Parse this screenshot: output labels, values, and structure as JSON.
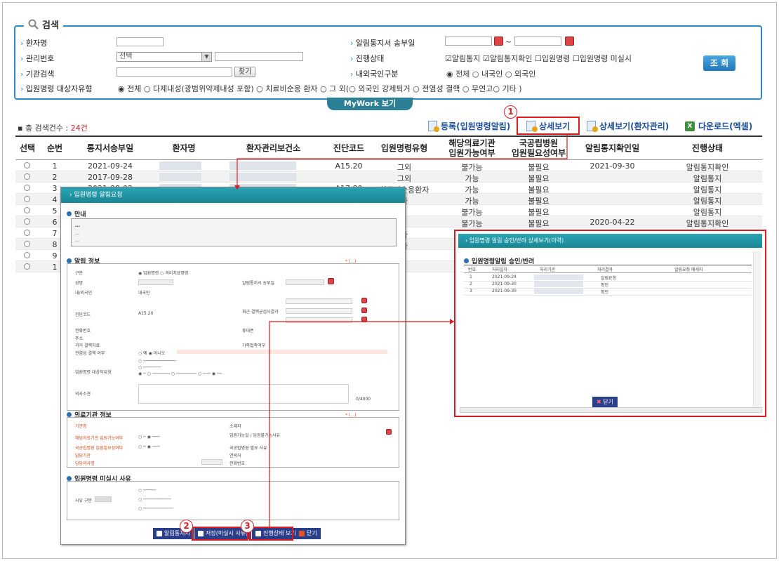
{
  "search": {
    "title": "검색",
    "patient_name_label": "환자명",
    "mgmt_no_label": "관리번호",
    "mgmt_select": "선택",
    "org_search_label": "기관검색",
    "find_btn": "찾기",
    "admission_type_label": "입원명령 대상자유형",
    "admission_type_options": [
      "전체",
      "다제내성(광범위약제내성 포함)",
      "치료비순응 환자",
      "그 외(",
      "외국인 강제퇴거",
      "전염성 결핵",
      "무연고",
      "기타 )"
    ],
    "notice_date_label": "알림통지서 송부일",
    "tilde": "~",
    "status_label": "진행상태",
    "status_options": [
      "알림통지",
      "알림통지확인",
      "입원명령",
      "입원명령 미실시"
    ],
    "nationality_label": "내외국인구분",
    "nationality_options": [
      "전체",
      "내국인",
      "외국인"
    ],
    "search_btn": "조 회",
    "mywork": "MyWork 보기"
  },
  "toolbar": {
    "count_prefix": "총 검색건수 : ",
    "count_value": "24건",
    "register_btn": "등록(입원명령알림)",
    "detail_btn": "상세보기",
    "detail_patient_btn": "상세보기(환자관리)",
    "download_btn": "다운로드(엑셀)"
  },
  "table": {
    "headers": [
      "선택",
      "순번",
      "통지서송부일",
      "환자명",
      "환자관리보건소",
      "진단코드",
      "입원명령유형",
      "해당의료기관\n입원가능여부",
      "국공립병원\n입원필요성여부",
      "알림통지확인일",
      "진행상태"
    ],
    "rows": [
      {
        "seq": "1",
        "date": "2021-09-24",
        "code": "A15.20",
        "type": "그외",
        "avail": "불가능",
        "need": "불필요",
        "confirm": "2021-09-30",
        "status": "알림통지확인"
      },
      {
        "seq": "2",
        "date": "2017-09-28",
        "code": "",
        "type": "그외",
        "avail": "가능",
        "need": "불필요",
        "confirm": "",
        "status": "알림통지"
      },
      {
        "seq": "3",
        "date": "2021-08-02",
        "code": "A17.80",
        "type": "치료비순응환자",
        "avail": "가능",
        "need": "불필요",
        "confirm": "",
        "status": "알림통지"
      },
      {
        "seq": "4",
        "date": "",
        "code": "",
        "type": "자",
        "avail": "가능",
        "need": "불필요",
        "confirm": "",
        "status": "알림통지"
      },
      {
        "seq": "5",
        "date": "",
        "code": "",
        "type": "",
        "avail": "불가능",
        "need": "불필요",
        "confirm": "",
        "status": "알림통지"
      },
      {
        "seq": "6",
        "date": "",
        "code": "",
        "type": "",
        "avail": "불가능",
        "need": "불필요",
        "confirm": "2020-04-22",
        "status": "알림통지확인"
      },
      {
        "seq": "7",
        "date": "",
        "code": "",
        "type": "자",
        "avail": "",
        "need": "",
        "confirm": "",
        "status": ""
      },
      {
        "seq": "8",
        "date": "",
        "code": "",
        "type": "자",
        "avail": "",
        "need": "",
        "confirm": "",
        "status": ""
      },
      {
        "seq": "9",
        "date": "",
        "code": "",
        "type": "",
        "avail": "",
        "need": "",
        "confirm": "",
        "status": ""
      },
      {
        "seq": "1",
        "date": "",
        "code": "",
        "type": "",
        "avail": "",
        "need": "",
        "confirm": "",
        "status": ""
      }
    ]
  },
  "popup1": {
    "title": "입원명령 알림요청",
    "sec_guide": "안내",
    "guide_bold": "…",
    "guide_line1": "…",
    "guide_line2": "…",
    "sec_alert": "알림 정보",
    "sec_alert_required": "* (…) ",
    "sec_hospital": "의료기관 정보",
    "sec_hospital_required": "* (…) ",
    "sec_reason": "입원명령 미실시 사유",
    "labels": [
      "구분",
      "성명",
      "내/외국인",
      "진단코드",
      "전화번호",
      "주소",
      "과거 결핵치료",
      "전염성 결핵 여부",
      "입원명령 대상자유형",
      "의사소견"
    ],
    "right_labels": [
      "알림통지서 송부일",
      "최근 결핵균검사결과",
      "휴대폰",
      "가족접촉여부"
    ],
    "hosp_labels": [
      "기관명",
      "해당의료기관 입원가능여부",
      "국공립병원 입원필요성여부",
      "담당기관",
      "담당의사명"
    ],
    "hosp_right_labels": [
      "소재지",
      "입원가능일 / 입원불가능사유",
      "국공립병원 필요 사유",
      "연락처",
      "전화번호"
    ],
    "reason_label": "사유 구분",
    "reason_btn": "",
    "value_diag": "A15.20",
    "value_nat": "내국인",
    "value_cnt": "0/4000",
    "btn_alert": "알림통지서",
    "btn_save": "저장(미실시 사유)",
    "btn_status": "진행상태 보기",
    "btn_close": "닫기"
  },
  "popup2": {
    "title": "입원명령 알림 승인/반려 상세보기(이력)",
    "section": "입원명령알림 승인/반려",
    "headers": [
      "번호",
      "처리일자",
      "처리기관",
      "처리결과",
      "알림요청 메세지"
    ],
    "rows": [
      {
        "no": "1",
        "date": "2021-09-24",
        "result": "알림요청"
      },
      {
        "no": "2",
        "date": "2021-09-30",
        "result": "확인"
      },
      {
        "no": "3",
        "date": "2021-09-30",
        "result": "확인"
      }
    ],
    "close_btn": "닫기"
  },
  "markers": [
    "1",
    "2",
    "3"
  ],
  "colors": {
    "accent": "#2a89c8",
    "teal": "#1a8795",
    "red": "#e0191f",
    "navy": "#2b3e8a"
  }
}
